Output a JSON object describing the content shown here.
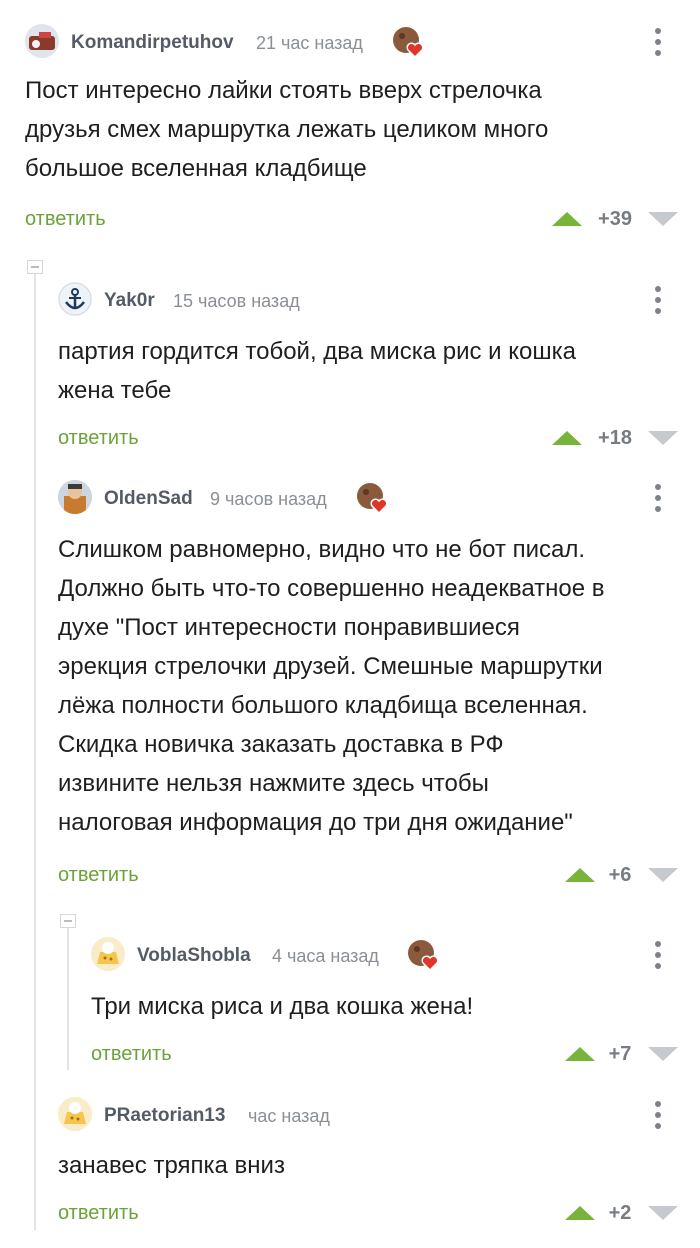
{
  "comments": [
    {
      "author": "Komandirpetuhov",
      "time": "21 час назад",
      "text": "Пост интересно лайки стоять вверх стрелочка\nдрузья смех маршрутка лежать целиком много\nбольшое вселенная кладбище",
      "reply_label": "ответить",
      "score": "+39"
    },
    {
      "author": "Yak0r",
      "time": "15 часов назад",
      "text": "партия гордится тобой, два миска рис и кошка\nжена тебе",
      "reply_label": "ответить",
      "score": "+18"
    },
    {
      "author": "OldenSad",
      "time": "9 часов назад",
      "text": "Слишком равномерно, видно что не бот писал.\nДолжно быть что-то совершенно неадекватное в\nдухе \"Пост интересности понравившиеся\nэрекция стрелочки друзей. Смешные маршрутки\nлёжа полности большого кладбища вселенная.\nСкидка новичка заказать доставка в РФ\nизвините нельзя нажмите здесь чтобы\nналоговая информация до три дня ожидание\"",
      "reply_label": "ответить",
      "score": "+6"
    },
    {
      "author": "VoblaShobla",
      "time": "4 часа назад",
      "text": "Три миска риса и два кошка жена!",
      "reply_label": "ответить",
      "score": "+7"
    },
    {
      "author": "PRaetorian13",
      "time": "час назад",
      "text": "занавес тряпка вниз",
      "reply_label": "ответить",
      "score": "+2"
    }
  ],
  "colors": {
    "accent_green": "#78b33a",
    "reply_green": "#6ba33a",
    "downvote_gray": "#c6c9cd"
  },
  "icons": {
    "menu": "more-vertical-icon",
    "upvote": "arrow-up-icon",
    "downvote": "arrow-down-icon",
    "badge": "heart-badge-icon",
    "collapse": "collapse-minus-icon"
  }
}
